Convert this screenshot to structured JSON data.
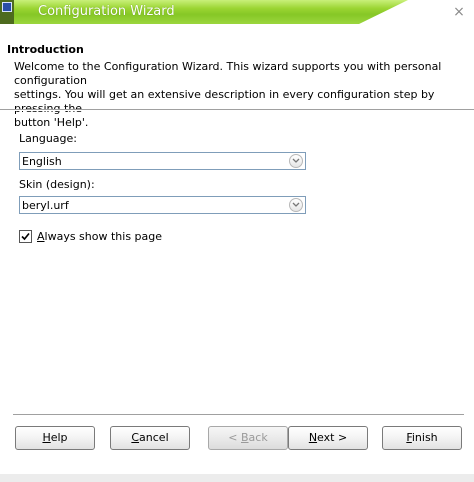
{
  "window": {
    "title": "Configuration Wizard",
    "close_glyph": "×"
  },
  "header": {
    "title": "Introduction",
    "description_line1": "Welcome to the Configuration Wizard. This wizard supports you with personal configuration",
    "description_line2": "settings. You will get an extensive description in every configuration step by pressing the",
    "description_line3": "button 'Help'."
  },
  "form": {
    "language_label": "Language:",
    "language_value": "English",
    "skin_label": "Skin (design):",
    "skin_value": "beryl.urf",
    "always_show_label": "Always show this page",
    "always_show_checked": true
  },
  "buttons": {
    "help": {
      "first": "H",
      "rest": "elp"
    },
    "cancel": {
      "first": "C",
      "rest": "ancel"
    },
    "back": {
      "prefix": "< ",
      "first": "B",
      "rest": "ack"
    },
    "next": {
      "first": "N",
      "rest": "ext >"
    },
    "finish": {
      "first": "F",
      "rest": "inish"
    }
  },
  "colors": {
    "titlebar_green": "#9bd533",
    "field_border": "#7f9db9"
  }
}
